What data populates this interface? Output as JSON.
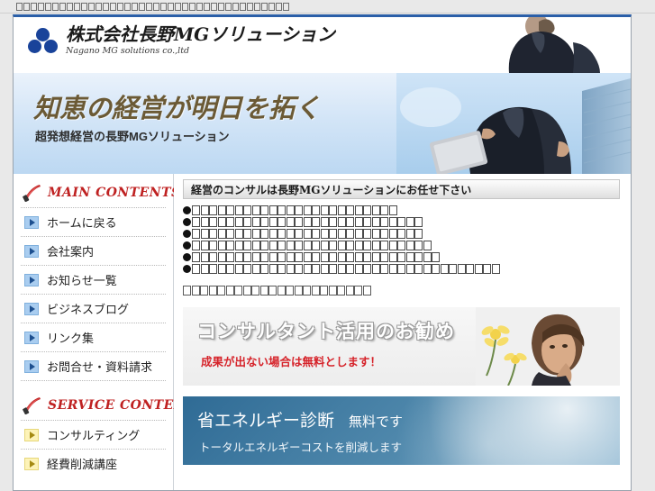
{
  "browser": {
    "title_missing_glyph_count": 38
  },
  "header": {
    "logo": {
      "icon": "three-circles-logo",
      "company_jp": "株式会社長野MGソリューション",
      "company_en": "Nagano MG solutions co.,ltd"
    },
    "photo_alt": "businessmen-with-briefcase-photo"
  },
  "hero": {
    "title": "知恵の経営が明日を拓く",
    "subtitle": "超発想経営の長野MGソリューション",
    "photo_alt": "businessman-walking-photo"
  },
  "sidebar": {
    "sections": [
      {
        "heading": "MAIN CONTENTS",
        "heading_icon": "quill-pen-icon",
        "bullet_style": "blue",
        "items": [
          {
            "label": "ホームに戻る"
          },
          {
            "label": "会社案内"
          },
          {
            "label": "お知らせ一覧"
          },
          {
            "label": "ビジネスブログ"
          },
          {
            "label": "リンク集"
          },
          {
            "label": "お問合せ・資料請求"
          }
        ]
      },
      {
        "heading": "SERVICE CONTENTS",
        "heading_icon": "quill-pen-icon",
        "bullet_style": "cream",
        "items": [
          {
            "label": "コンサルティング"
          },
          {
            "label": "経費削減講座"
          }
        ]
      }
    ]
  },
  "content": {
    "section_title": "経営のコンサルは長野MGソリューションにお任せ下さい",
    "bullet_lines_glyph_counts": [
      24,
      27,
      27,
      28,
      29,
      36
    ],
    "note_line_glyph_count": 22,
    "banners": [
      {
        "name": "consultant-banner",
        "title": "コンサルタント活用のお勧め",
        "subtitle": "成果が出ない場合は無料とします！",
        "photo_alt": "thinking-woman-photo"
      },
      {
        "name": "energy-banner",
        "title": "省エネルギー診断",
        "title_small": "無料です",
        "subtitle": "トータルエネルギーコストを削減します",
        "photo_alt": "blue-sky-clouds-photo"
      }
    ]
  },
  "colors": {
    "brand_blue": "#19439a",
    "accent_red": "#bf2121",
    "heading_brown": "#6b5a35",
    "energy_blue": "#2f6b95",
    "top_border": "#2b5fa8"
  }
}
